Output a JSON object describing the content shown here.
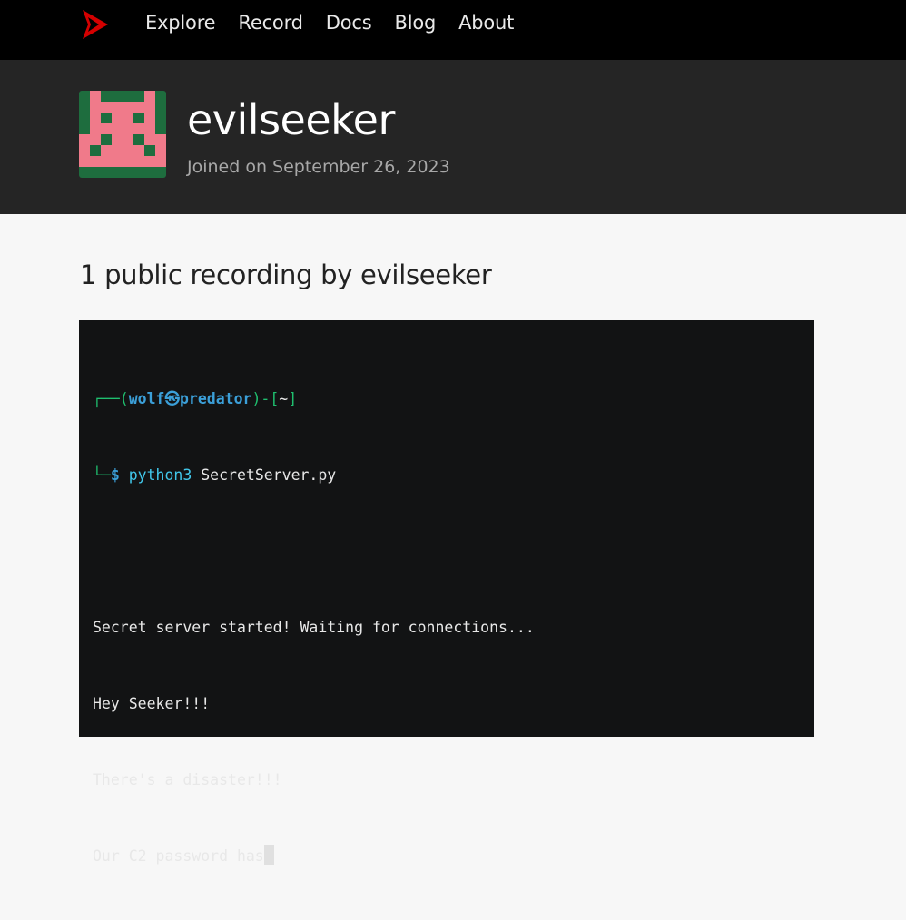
{
  "nav": {
    "items": [
      "Explore",
      "Record",
      "Docs",
      "Blog",
      "About"
    ]
  },
  "profile": {
    "username": "evilseeker",
    "joined": "Joined on September 26, 2023"
  },
  "section": {
    "title": "1 public recording by evilseeker"
  },
  "terminal": {
    "prompt_open": "┌──(",
    "prompt_user": "wolf㉿predator",
    "prompt_close": ")-[",
    "prompt_dir": "~",
    "prompt_end": "]",
    "cmd_prefix": "└─",
    "cmd_dollar": "$",
    "cmd_name": "python3",
    "cmd_arg": " SecretServer.py",
    "output": [
      "Secret server started! Waiting for connections...",
      "Hey Seeker!!!",
      "There's a disaster!!!",
      "Our C2 password has"
    ]
  },
  "colors": {
    "nav_bg": "#000000",
    "header_bg": "#252525",
    "terminal_bg": "#121314",
    "logo_red": "#d40000",
    "avatar_green": "#1e6d3e",
    "avatar_pink": "#f07a8a"
  },
  "icons": {
    "logo": "asciinema-logo-icon",
    "avatar": "pixel-identicon"
  }
}
